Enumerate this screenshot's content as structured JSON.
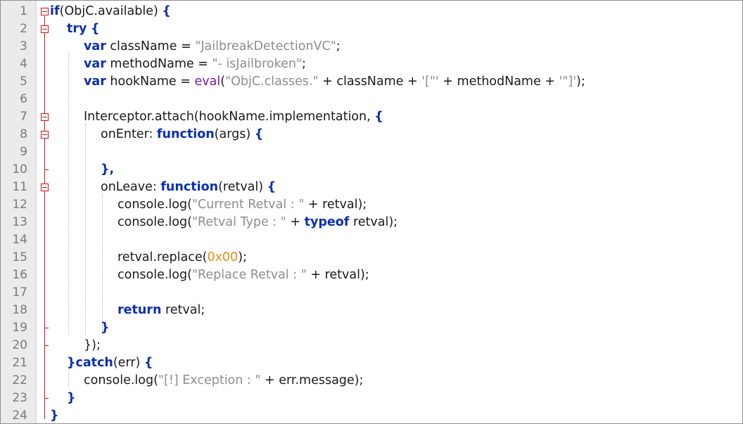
{
  "line_numbers": [
    "1",
    "2",
    "3",
    "4",
    "5",
    "6",
    "7",
    "8",
    "9",
    "10",
    "11",
    "12",
    "13",
    "14",
    "15",
    "16",
    "17",
    "18",
    "19",
    "20",
    "21",
    "22",
    "23",
    "24"
  ],
  "lines": [
    [
      {
        "t": "if",
        "c": "kw"
      },
      {
        "t": "(ObjC.available) "
      },
      {
        "t": "{",
        "c": "kw"
      }
    ],
    [
      {
        "t": "try",
        "c": "kw"
      },
      {
        "t": " "
      },
      {
        "t": "{",
        "c": "kw"
      }
    ],
    [
      {
        "t": "var",
        "c": "vk"
      },
      {
        "t": " className "
      },
      {
        "t": "=",
        "c": "op"
      },
      {
        "t": " "
      },
      {
        "t": "\"JailbreakDetectionVC\"",
        "c": "str"
      },
      {
        "t": ";"
      }
    ],
    [
      {
        "t": "var",
        "c": "vk"
      },
      {
        "t": " methodName "
      },
      {
        "t": "=",
        "c": "op"
      },
      {
        "t": " "
      },
      {
        "t": "\"- isJailbroken\"",
        "c": "str"
      },
      {
        "t": ";"
      }
    ],
    [
      {
        "t": "var",
        "c": "vk"
      },
      {
        "t": " hookName "
      },
      {
        "t": "=",
        "c": "op"
      },
      {
        "t": " "
      },
      {
        "t": "eval",
        "c": "fn"
      },
      {
        "t": "("
      },
      {
        "t": "\"ObjC.classes.\"",
        "c": "str"
      },
      {
        "t": " + className + "
      },
      {
        "t": "'[\"'",
        "c": "str"
      },
      {
        "t": " + methodName + "
      },
      {
        "t": "'\"]'",
        "c": "str"
      },
      {
        "t": ");"
      }
    ],
    [],
    [
      {
        "t": "Interceptor.attach(hookName.implementation, "
      },
      {
        "t": "{",
        "c": "kw"
      }
    ],
    [
      {
        "t": "onEnter: "
      },
      {
        "t": "function",
        "c": "kw"
      },
      {
        "t": "(args) "
      },
      {
        "t": "{",
        "c": "kw"
      }
    ],
    [],
    [
      {
        "t": "},",
        "c": "kw"
      }
    ],
    [
      {
        "t": "onLeave: "
      },
      {
        "t": "function",
        "c": "kw"
      },
      {
        "t": "(retval) "
      },
      {
        "t": "{",
        "c": "kw"
      }
    ],
    [
      {
        "t": "console.log("
      },
      {
        "t": "\"Current Retval : \"",
        "c": "str"
      },
      {
        "t": " + retval);"
      }
    ],
    [
      {
        "t": "console.log("
      },
      {
        "t": "\"Retval Type : \"",
        "c": "str"
      },
      {
        "t": " + "
      },
      {
        "t": "typeof",
        "c": "kw"
      },
      {
        "t": " retval);"
      }
    ],
    [],
    [
      {
        "t": "retval.replace("
      },
      {
        "t": "0x00",
        "c": "num"
      },
      {
        "t": ");"
      }
    ],
    [
      {
        "t": "console.log("
      },
      {
        "t": "\"Replace Retval : \"",
        "c": "str"
      },
      {
        "t": " + retval);"
      }
    ],
    [],
    [
      {
        "t": "return",
        "c": "kw"
      },
      {
        "t": " retval;"
      }
    ],
    [
      {
        "t": "}",
        "c": "kw"
      }
    ],
    [
      {
        "t": "});"
      }
    ],
    [
      {
        "t": "}catch",
        "c": "kw"
      },
      {
        "t": "(err) "
      },
      {
        "t": "{",
        "c": "kw"
      }
    ],
    [
      {
        "t": "console.log("
      },
      {
        "t": "\"[!] Exception : \"",
        "c": "str"
      },
      {
        "t": " + err.message);"
      }
    ],
    [
      {
        "t": "}",
        "c": "kw"
      }
    ],
    [
      {
        "t": "}",
        "c": "kw"
      }
    ]
  ],
  "fold_markers": [
    1,
    2,
    7,
    8,
    11
  ]
}
